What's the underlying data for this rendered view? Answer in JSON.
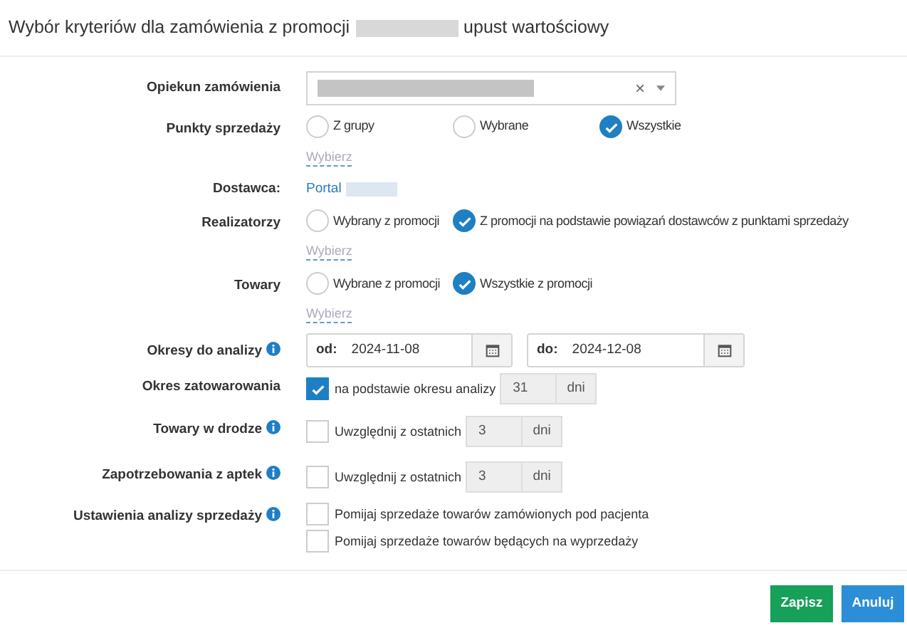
{
  "dialog": {
    "title_start": "Wybór kryteriów dla zamówienia z promocji",
    "title_end": "upust wartościowy"
  },
  "form": [
    {
      "kind": "select",
      "label": "Opiekun zamówienia",
      "clear": "×"
    },
    {
      "kind": "radio",
      "label": "Punkty sprzedaży",
      "options": [
        {
          "label": "Z grupy",
          "selected": false
        },
        {
          "label": "Wybrane",
          "selected": false
        },
        {
          "label": "Wszystkie",
          "selected": true
        }
      ],
      "link": "Wybierz"
    },
    {
      "kind": "text_link",
      "label": "Dostawca:",
      "value": "Portal"
    },
    {
      "kind": "radio",
      "label": "Realizatorzy",
      "options": [
        {
          "label": "Wybrany z promocji",
          "selected": false
        },
        {
          "label": "Z promocji na podstawie powiązań dostawców z punktami sprzedaży",
          "selected": true
        }
      ],
      "link": "Wybierz"
    },
    {
      "kind": "radio",
      "label": "Towary",
      "options": [
        {
          "label": "Wybrane z promocji",
          "selected": false
        },
        {
          "label": "Wszystkie z promocji",
          "selected": true
        }
      ],
      "link": "Wybierz"
    },
    {
      "kind": "dates",
      "label": "Okresy do analizy",
      "info": true,
      "from_label": "od:",
      "from": "2024-11-08",
      "to_label": "do:",
      "to": "2024-12-08"
    },
    {
      "kind": "checkbox_days",
      "label": "Okres zatowarowania",
      "checked": true,
      "text": "na podstawie okresu analizy",
      "days": "31",
      "unit": "dni"
    },
    {
      "kind": "checkbox_days",
      "label": "Towary w drodze",
      "info": true,
      "checked": false,
      "text": "Uwzględnij z ostatnich",
      "days": "3",
      "unit": "dni"
    },
    {
      "kind": "checkbox_days",
      "label": "Zapotrzebowania z aptek",
      "info": true,
      "checked": false,
      "text": "Uwzględnij z ostatnich",
      "days": "3",
      "unit": "dni"
    },
    {
      "kind": "checkboxes",
      "label": "Ustawienia analizy sprzedaży",
      "info": true,
      "items": [
        {
          "label": "Pomijaj sprzedaże towarów zamówionych pod pacjenta",
          "checked": false
        },
        {
          "label": "Pomijaj sprzedaże towarów będących na wyprzedaży",
          "checked": false
        }
      ]
    }
  ],
  "buttons": [
    {
      "label": "Zapisz",
      "kind": "primary"
    },
    {
      "label": "Anuluj",
      "kind": "secondary"
    }
  ]
}
